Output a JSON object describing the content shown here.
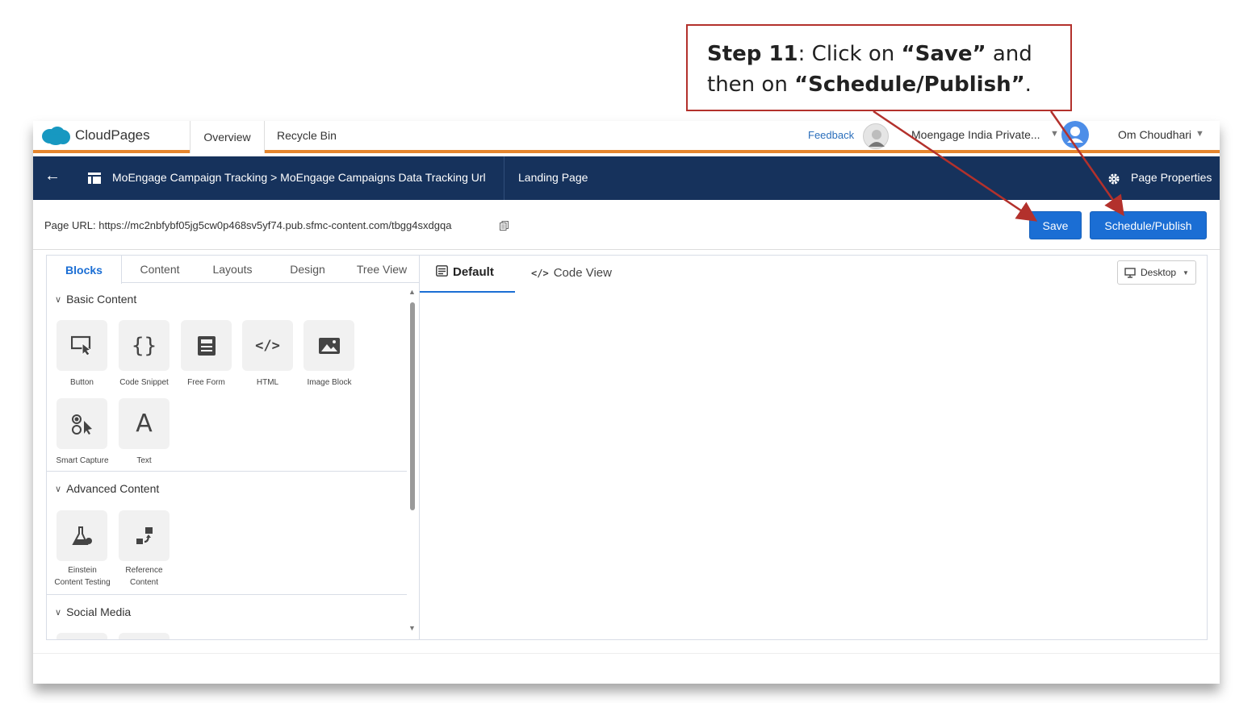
{
  "callout": {
    "step_label": "Step 11",
    "text_1": ": Click on ",
    "save_quote": "“Save”",
    "text_2": " and",
    "text_3": "then on ",
    "publish_quote": "“Schedule/Publish”",
    "text_4": "."
  },
  "topbar": {
    "app_name": "CloudPages",
    "tabs": [
      "Overview",
      "Recycle Bin"
    ],
    "feedback": "Feedback",
    "org_name": "Moengage India Private...",
    "user_name": "Om Choudhari"
  },
  "navbar": {
    "breadcrumb": "MoEngage Campaign Tracking > MoEngage Campaigns Data Tracking Url",
    "page_type": "Landing Page",
    "page_properties": "Page Properties"
  },
  "url_row": {
    "label": "Page URL:",
    "url": "https://mc2nbfybf05jg5cw0p468sv5yf74.pub.sfmc-content.com/tbgg4sxdgqa",
    "save_label": "Save",
    "publish_label": "Schedule/Publish"
  },
  "left_panel": {
    "tabs": [
      "Blocks",
      "Content",
      "Layouts",
      "Design",
      "Tree View"
    ],
    "sections": [
      {
        "title": "Basic Content",
        "blocks": [
          "Button",
          "Code Snippet",
          "Free Form",
          "HTML",
          "Image Block",
          "Smart Capture",
          "Text"
        ]
      },
      {
        "title": "Advanced Content",
        "blocks": [
          "Einstein Content Testing",
          "Reference Content"
        ]
      },
      {
        "title": "Social Media",
        "blocks": []
      }
    ],
    "block_label_lines": {
      "einstein_1": "Einstein",
      "einstein_2": "Content Testing",
      "reference_1": "Reference",
      "reference_2": "Content"
    }
  },
  "canvas": {
    "tab_default": "Default",
    "tab_code": "Code View",
    "device": "Desktop"
  },
  "colors": {
    "navbar": "#16325c",
    "accent_orange": "#e5862e",
    "button_blue": "#1b6ed4",
    "callout_border": "#b3312c"
  }
}
